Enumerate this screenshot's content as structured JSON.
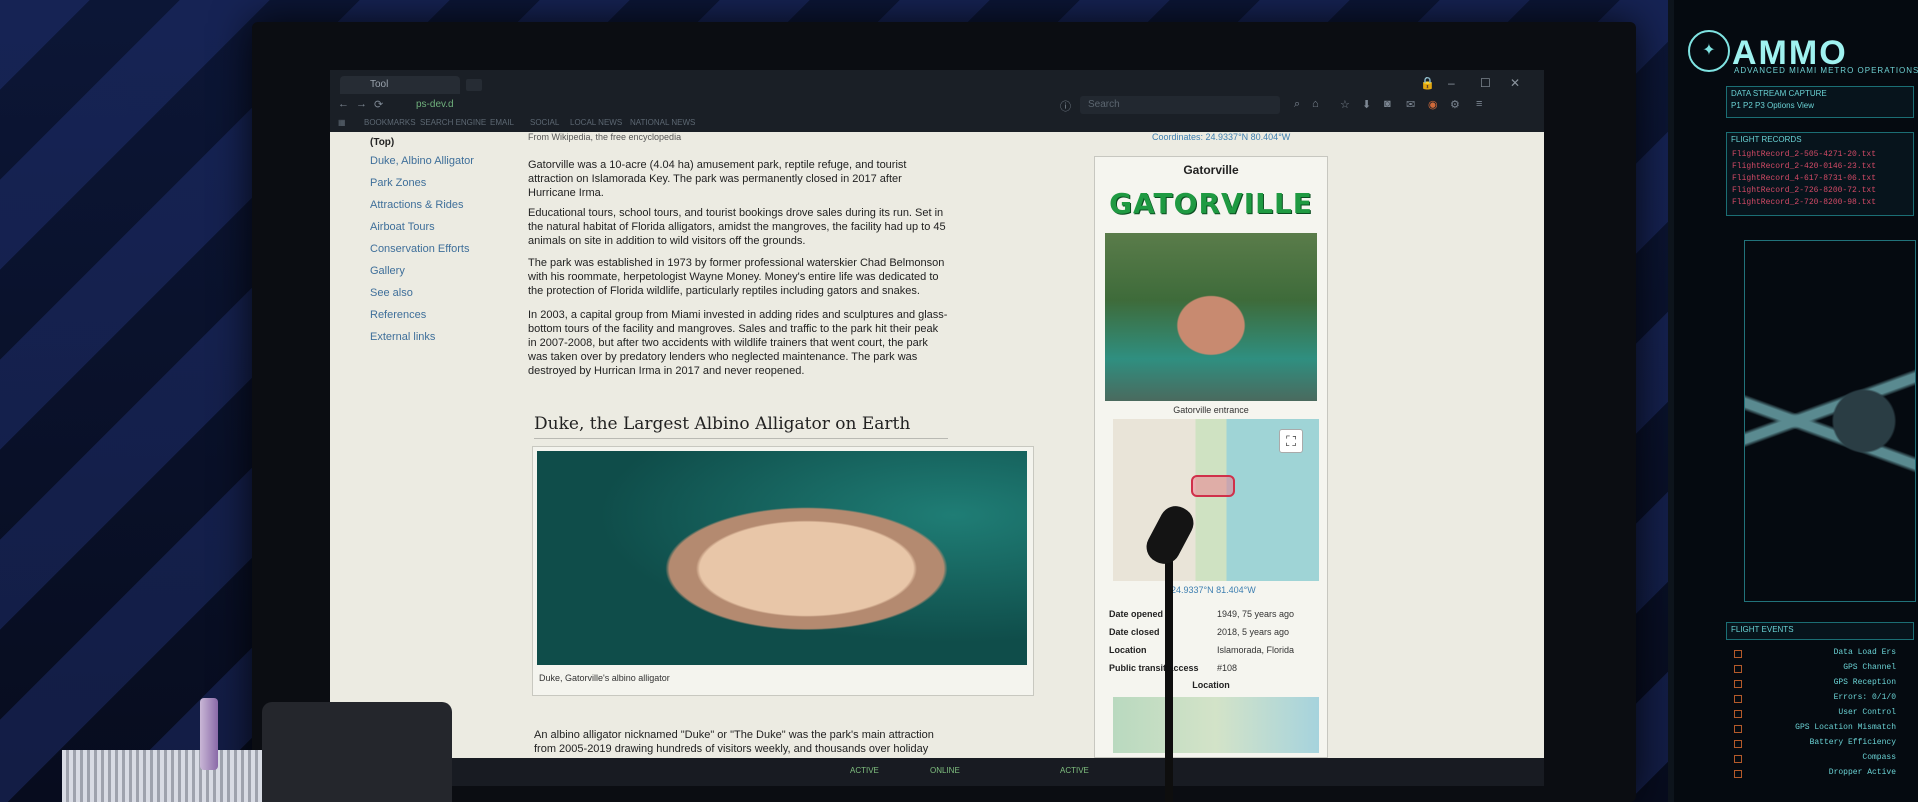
{
  "browser": {
    "tab_title": "Tool",
    "url": "ps-dev.d",
    "search_placeholder": "Search",
    "bookmarks": [
      "BOOKMARKS",
      "SEARCH ENGINE",
      "EMAIL",
      "SOCIAL",
      "LOCAL NEWS",
      "NATIONAL NEWS"
    ]
  },
  "article": {
    "from": "From Wikipedia, the free encyclopedia",
    "coordinates": "Coordinates: 24.9337°N 80.404°W",
    "toc": {
      "top": "(Top)",
      "items": [
        "Duke, Albino Alligator",
        "Park Zones",
        "Attractions & Rides",
        "Airboat Tours",
        "Conservation Efforts",
        "Gallery",
        "See also",
        "References",
        "External links"
      ]
    },
    "paragraphs": {
      "p1": "Gatorville was a 10-acre (4.04 ha) amusement park, reptile refuge, and tourist attraction on Islamorada Key. The park was permanently closed in 2017 after Hurricane Irma.",
      "p2": "Educational tours, school tours, and tourist bookings drove sales during its run. Set in the natural habitat of Florida alligators, amidst the mangroves, the facility had up to 45 animals on site in addition to wild visitors off the grounds.",
      "p3": "The park was established in 1973 by former professional waterskier Chad Belmonson with his roommate, herpetologist Wayne Money. Money's entire life was dedicated to the protection of Florida wildlife, particularly reptiles including gators and snakes.",
      "p4": "In 2003, a capital group from Miami invested in adding rides and sculptures and glass-bottom tours of the facility and mangroves. Sales and traffic to the park hit their peak in 2007-2008, but after two accidents with wildlife trainers that went court, the park was taken over by predatory lenders who neglected maintenance. The park was destroyed by Hurrican Irma in 2017 and never reopened.",
      "p5": "An albino alligator nicknamed \"Duke\" or \"The Duke\" was the park's main attraction from 2005-2019 drawing hundreds of visitors weekly, and thousands over holiday weekends. At over 16 feet in length, and estimated to weigh nearly 900 pounds, Duke was also the key piece of merchandise in Gatorville souvenirs after his arrival."
    },
    "section_heading": "Duke, the Largest Albino Alligator on Earth",
    "figure_caption": "Duke, Gatorville's albino alligator"
  },
  "infobox": {
    "title": "Gatorville",
    "logo_text": "GATORVILLE",
    "image_caption": "Gatorville entrance",
    "map_coords": "24.9337°N 81.404°W",
    "expand_icon": "⛶",
    "rows": [
      {
        "k": "Date opened",
        "v": "1949, 75 years ago"
      },
      {
        "k": "Date closed",
        "v": "2018, 5 years ago"
      },
      {
        "k": "Location",
        "v": "Islamorada, Florida"
      },
      {
        "k": "Public transit access",
        "v": "#108"
      }
    ],
    "location_heading": "Location"
  },
  "taskbar": {
    "statuses": [
      "ACTIVE",
      "ONLINE",
      "ACTIVE"
    ]
  },
  "right_monitor": {
    "brand": "AMMO",
    "brand_sub": "ADVANCED MIAMI METRO OPERATIONS",
    "data_stream": "DATA STREAM CAPTURE",
    "tabs": "P1   P2   P3        Options   View",
    "flight_records_label": "FLIGHT RECORDS",
    "records": [
      "FlightRecord_2-505-4271-20.txt",
      "FlightRecord_2-420-0146-23.txt",
      "FlightRecord_4-617-8731-06.txt",
      "FlightRecord_2-726-8200-72.txt",
      "FlightRecord_2-720-8200-98.txt"
    ],
    "events_label": "FLIGHT EVENTS",
    "events": [
      "Data Load Ers",
      "GPS Channel",
      "GPS Reception",
      "Errors: 0/1/0",
      "User Control",
      "GPS Location Mismatch",
      "Battery Efficiency",
      "Compass",
      "Dropper Active"
    ]
  }
}
